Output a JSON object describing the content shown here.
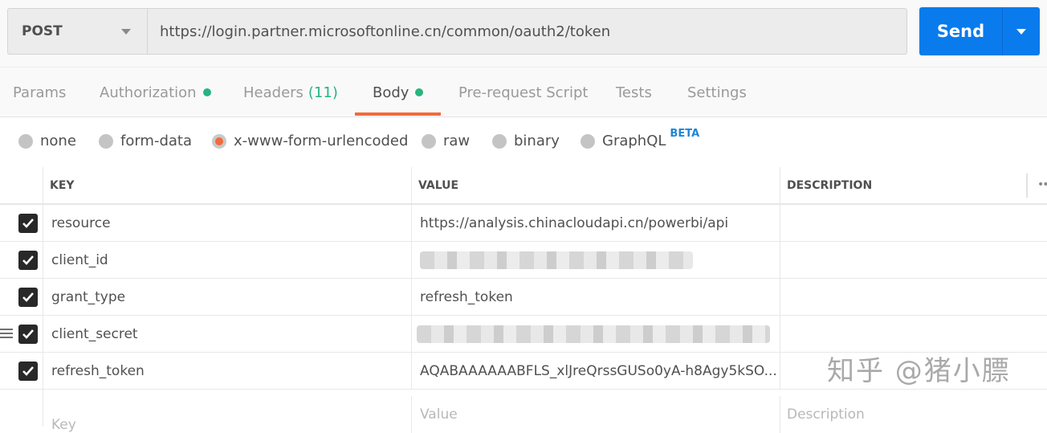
{
  "request": {
    "method": "POST",
    "url": "https://login.partner.microsoftonline.cn/common/oauth2/token",
    "send_label": "Send"
  },
  "tabs": [
    {
      "label": "Params"
    },
    {
      "label": "Authorization",
      "dot": true
    },
    {
      "label": "Headers",
      "count": "(11)"
    },
    {
      "label": "Body",
      "dot": true,
      "active": true
    },
    {
      "label": "Pre-request Script"
    },
    {
      "label": "Tests"
    },
    {
      "label": "Settings"
    }
  ],
  "body_types": [
    {
      "label": "none"
    },
    {
      "label": "form-data"
    },
    {
      "label": "x-www-form-urlencoded",
      "selected": true
    },
    {
      "label": "raw"
    },
    {
      "label": "binary"
    },
    {
      "label": "GraphQL",
      "badge": "BETA"
    }
  ],
  "table": {
    "headers": {
      "key": "KEY",
      "value": "VALUE",
      "description": "DESCRIPTION",
      "more": "••"
    },
    "rows": [
      {
        "key": "resource",
        "value": "https://analysis.chinacloudapi.cn/powerbi/api",
        "checked": true
      },
      {
        "key": "client_id",
        "value": "",
        "blurred": true,
        "checked": true
      },
      {
        "key": "grant_type",
        "value": "refresh_token",
        "checked": true
      },
      {
        "key": "client_secret",
        "value": "",
        "blurred": true,
        "checked": true,
        "drag_handle": true
      },
      {
        "key": "refresh_token",
        "value": "AQABAAAAAABFLS_xlJreQrssGUSo0yA-h8Agy5kSO...",
        "checked": true
      }
    ],
    "new_row": {
      "key_placeholder": "Key",
      "value_placeholder": "Value",
      "description_placeholder": "Description"
    }
  },
  "watermark": "知乎 @猪小膘",
  "colors": {
    "accent": "#f26b3a",
    "send": "#097bed",
    "dot": "#26b47f",
    "beta": "#1e86d6"
  }
}
